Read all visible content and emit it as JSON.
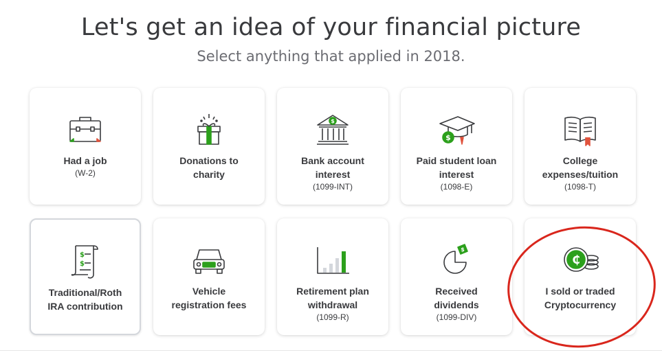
{
  "header": {
    "title": "Let's get an idea of your financial picture",
    "subtitle": "Select anything that applied in 2018."
  },
  "colors": {
    "accent_green": "#2ca01c",
    "text": "#393a3d",
    "highlight_circle": "#d9261c"
  },
  "cards": [
    {
      "label_line1": "Had a job",
      "label_line2": "",
      "sub": "(W-2)",
      "icon": "briefcase-icon",
      "selected": false
    },
    {
      "label_line1": "Donations to",
      "label_line2": "charity",
      "sub": "",
      "icon": "gift-icon",
      "selected": false
    },
    {
      "label_line1": "Bank account",
      "label_line2": "interest",
      "sub": "(1099-INT)",
      "icon": "bank-icon",
      "selected": false
    },
    {
      "label_line1": "Paid student loan",
      "label_line2": "interest",
      "sub": "(1098-E)",
      "icon": "graduation-cap-icon",
      "selected": false
    },
    {
      "label_line1": "College",
      "label_line2": "expenses/tuition",
      "sub": "(1098-T)",
      "icon": "open-book-icon",
      "selected": false
    },
    {
      "label_line1": "Traditional/Roth",
      "label_line2": "IRA contribution",
      "sub": "",
      "icon": "scroll-document-icon",
      "selected": true
    },
    {
      "label_line1": "Vehicle",
      "label_line2": "registration fees",
      "sub": "",
      "icon": "car-icon",
      "selected": false
    },
    {
      "label_line1": "Retirement plan",
      "label_line2": "withdrawal",
      "sub": "(1099-R)",
      "icon": "bar-chart-icon",
      "selected": false
    },
    {
      "label_line1": "Received",
      "label_line2": "dividends",
      "sub": "(1099-DIV)",
      "icon": "pie-chart-icon",
      "selected": false
    },
    {
      "label_line1": "I sold or traded",
      "label_line2": "Cryptocurrency",
      "sub": "",
      "icon": "crypto-coin-icon",
      "selected": false
    }
  ]
}
